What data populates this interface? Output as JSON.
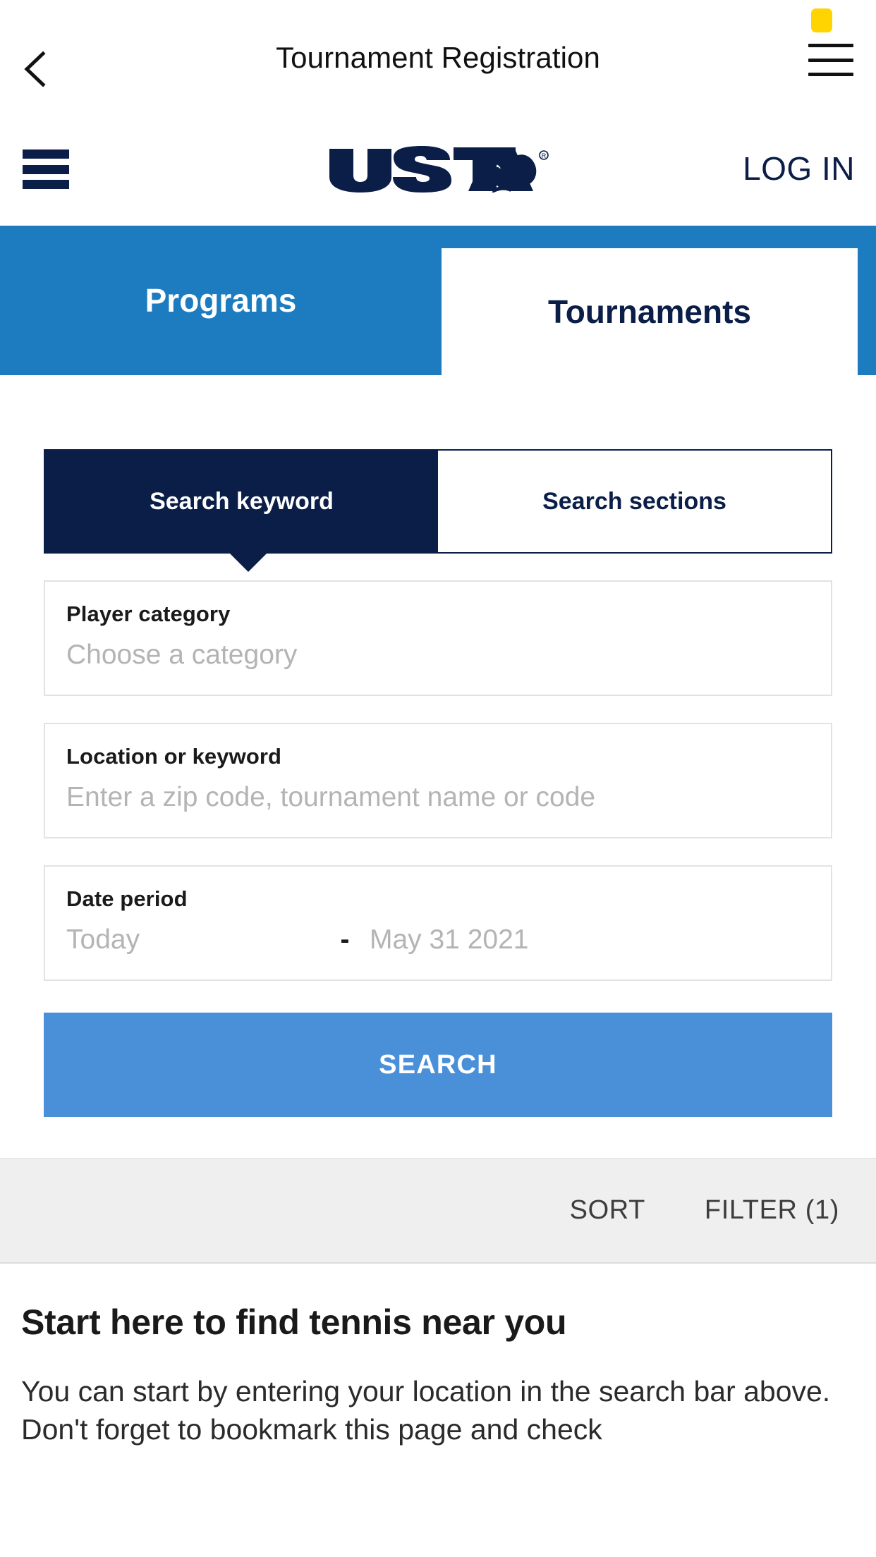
{
  "app_chrome": {
    "title": "Tournament Registration",
    "back_icon": "chevron-left-icon",
    "menu_icon": "hamburger-menu-icon",
    "status_badge_color": "#FFD400"
  },
  "brand_bar": {
    "menu_icon": "hamburger-menu-icon",
    "logo_text": "USTA",
    "logo_registered_mark": "®",
    "login_label": "LOG IN",
    "brand_color": "#0a1e48"
  },
  "primary_tabs": {
    "bar_color": "#1c7cbf",
    "items": [
      {
        "label": "Programs",
        "active": false
      },
      {
        "label": "Tournaments",
        "active": true
      }
    ]
  },
  "search_panel": {
    "toggle": {
      "items": [
        {
          "label": "Search keyword",
          "active": true
        },
        {
          "label": "Search sections",
          "active": false
        }
      ],
      "active_color": "#0a1e48"
    },
    "fields": [
      {
        "name": "player-category",
        "label": "Player category",
        "placeholder": "Choose a category",
        "value": ""
      },
      {
        "name": "location-or-keyword",
        "label": "Location or keyword",
        "placeholder": "Enter a zip code, tournament name or code",
        "value": ""
      }
    ],
    "date_period": {
      "label": "Date period",
      "from": "Today",
      "separator": "-",
      "to": "May 31 2021"
    },
    "search_button": {
      "label": "SEARCH",
      "color": "#4a90d9"
    }
  },
  "sort_filter_bar": {
    "background": "#efefef",
    "sort_label": "SORT",
    "filter_label": "FILTER (1)",
    "filter_count": 1
  },
  "intro": {
    "heading": "Start here to find tennis near you",
    "body": "You can start by entering your location in the search bar above. Don't forget to bookmark this page and check"
  }
}
